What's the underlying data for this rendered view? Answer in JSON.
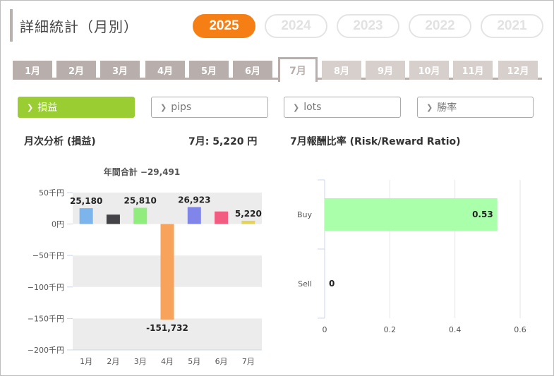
{
  "header": {
    "title": "詳細統計（月別）"
  },
  "years": [
    {
      "label": "2025",
      "active": true
    },
    {
      "label": "2024",
      "active": false
    },
    {
      "label": "2023",
      "active": false
    },
    {
      "label": "2022",
      "active": false
    },
    {
      "label": "2021",
      "active": false
    }
  ],
  "months": [
    "1月",
    "2月",
    "3月",
    "4月",
    "5月",
    "6月",
    "7月",
    "8月",
    "9月",
    "10月",
    "11月",
    "12月"
  ],
  "selected_month_index": 6,
  "metrics": [
    {
      "label": "損益",
      "active": true
    },
    {
      "label": "pips",
      "active": false
    },
    {
      "label": "lots",
      "active": false
    },
    {
      "label": "勝率",
      "active": false
    }
  ],
  "left_chart": {
    "heading": "月次分析 (損益)",
    "month_summary": "7月:  5,220 円",
    "annual_total": "年間合計 −29,491"
  },
  "right_chart": {
    "heading": "7月報酬比率 (Risk/Reward Ratio)"
  },
  "chart_data": [
    {
      "type": "bar",
      "title": "年間合計 −29,491",
      "categories": [
        "1月",
        "2月",
        "3月",
        "4月",
        "5月",
        "6月",
        "7月"
      ],
      "values": [
        25180,
        15000,
        25810,
        -151732,
        26923,
        20000,
        5220
      ],
      "value_labels": [
        "25,180",
        "",
        "25,810",
        "-151,732",
        "26,923",
        "",
        "5,220"
      ],
      "colors": [
        "#7cb5ec",
        "#434348",
        "#90ed7d",
        "#f7a35c",
        "#8085e9",
        "#f15c80",
        "#e4d354"
      ],
      "ylim": [
        -200000,
        50000
      ],
      "yticks": [
        50000,
        0,
        -50000,
        -100000,
        -150000,
        -200000
      ],
      "ytick_labels": [
        "50千円",
        "0円",
        "−50千円",
        "−100千円",
        "−150千円",
        "−200千円"
      ]
    },
    {
      "type": "bar",
      "orientation": "horizontal",
      "categories": [
        "Buy",
        "Sell"
      ],
      "values": [
        0.53,
        0
      ],
      "value_labels": [
        "0.53",
        "0"
      ],
      "color": "#aaffaa",
      "xlim": [
        0,
        0.6
      ],
      "xticks": [
        "0",
        "0.2",
        "0.4",
        "0.6"
      ]
    }
  ]
}
